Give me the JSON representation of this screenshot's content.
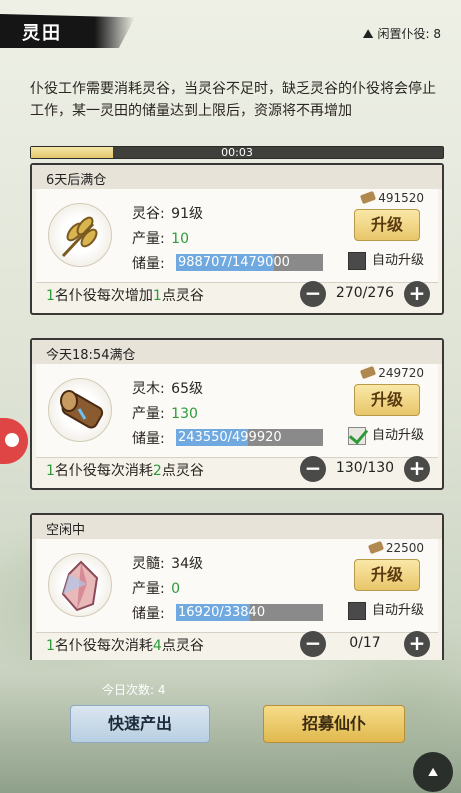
{
  "header": {
    "title": "灵田",
    "idle_label": "闲置仆役:",
    "idle_count": "8"
  },
  "description": "仆役工作需要消耗灵谷，当灵谷不足时，缺乏灵谷的仆役将会停止工作，某一灵田的储量达到上限后，资源将不再增加",
  "timer": {
    "text": "00:03",
    "progress": 0.2
  },
  "cards": [
    {
      "status": "6天后满仓",
      "name_label": "灵谷:",
      "level": "91级",
      "output_label": "产量:",
      "output": "10",
      "storage_label": "储量:",
      "storage": "988707/1479000",
      "storage_fill": 0.668,
      "cost": "491520",
      "upgrade": "升级",
      "auto": "自动升级",
      "auto_checked": false,
      "foot_pre": "1",
      "foot_mid": "名仆役每次增加",
      "foot_num": "1",
      "foot_post": "点灵谷",
      "stepper": "270/276"
    },
    {
      "status": "今天18:54满仓",
      "name_label": "灵木:",
      "level": "65级",
      "output_label": "产量:",
      "output": "130",
      "storage_label": "储量:",
      "storage": "243550/499920",
      "storage_fill": 0.487,
      "cost": "249720",
      "upgrade": "升级",
      "auto": "自动升级",
      "auto_checked": true,
      "foot_pre": "1",
      "foot_mid": "名仆役每次消耗",
      "foot_num": "2",
      "foot_post": "点灵谷",
      "stepper": "130/130"
    },
    {
      "status": "空闲中",
      "name_label": "灵髓:",
      "level": "34级",
      "output_label": "产量:",
      "output": "0",
      "storage_label": "储量:",
      "storage": "16920/33840",
      "storage_fill": 0.5,
      "cost": "22500",
      "upgrade": "升级",
      "auto": "自动升级",
      "auto_checked": false,
      "foot_pre": "1",
      "foot_mid": "名仆役每次消耗",
      "foot_num": "4",
      "foot_post": "点灵谷",
      "stepper": "0/17"
    }
  ],
  "footer": {
    "today_label": "今日次数:",
    "today_count": "4",
    "quick": "快速产出",
    "recruit": "招募仙仆"
  }
}
